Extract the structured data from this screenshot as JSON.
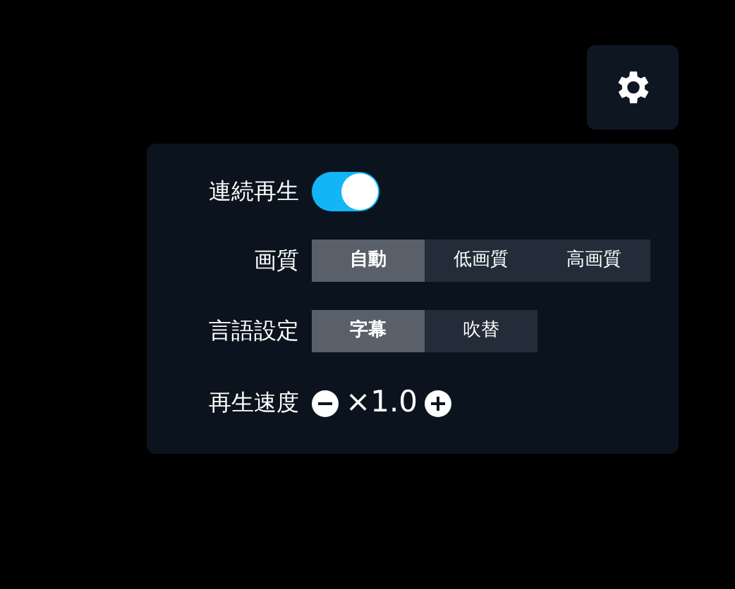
{
  "settings_button": {
    "selected": false
  },
  "rows": [
    {
      "kind": "toggle",
      "label": "連続再生",
      "on": true
    },
    {
      "kind": "segments",
      "label": "画質",
      "options": [
        {
          "label": "自動",
          "selected": true
        },
        {
          "label": "低画質",
          "selected": false
        },
        {
          "label": "高画質",
          "selected": false
        }
      ]
    },
    {
      "kind": "segments",
      "label": "言語設定",
      "options": [
        {
          "label": "字幕",
          "selected": true
        },
        {
          "label": "吹替",
          "selected": false
        }
      ]
    },
    {
      "kind": "stepper",
      "label": "再生速度",
      "value": "×1.0"
    }
  ]
}
